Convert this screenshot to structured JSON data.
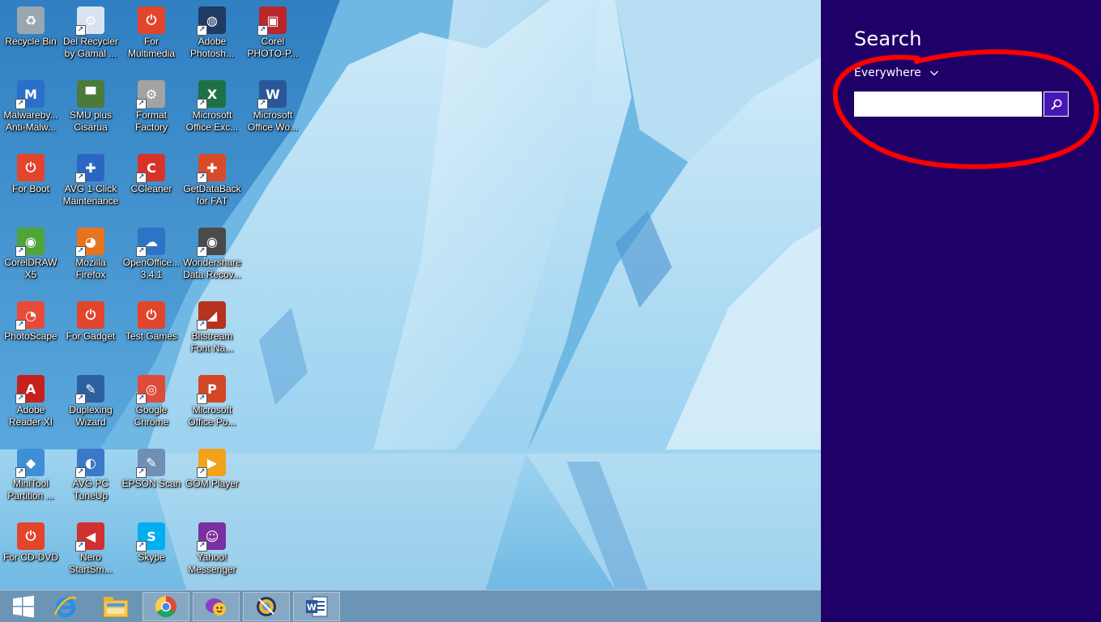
{
  "desktop": {
    "icons": [
      {
        "label": "Recycle Bin",
        "icon": "recycle-bin-icon",
        "color": "#9aa7b2",
        "glyph": "♻",
        "shortcut": false
      },
      {
        "label": "Malwareby... Anti-Malw...",
        "icon": "malwarebytes-icon",
        "color": "#2a6fc9",
        "glyph": "M",
        "shortcut": true
      },
      {
        "label": "For Boot",
        "icon": "power-icon",
        "color": "#e2442c",
        "glyph": "⏻",
        "shortcut": false
      },
      {
        "label": "CorelDRAW X5",
        "icon": "coreldraw-icon",
        "color": "#4fa43a",
        "glyph": "◉",
        "shortcut": true
      },
      {
        "label": "PhotoScape",
        "icon": "photoscape-icon",
        "color": "#e84a3a",
        "glyph": "◔",
        "shortcut": true
      },
      {
        "label": "Adobe Reader XI",
        "icon": "adobe-reader-icon",
        "color": "#c8201b",
        "glyph": "A",
        "shortcut": true
      },
      {
        "label": "MiniTool Partition ...",
        "icon": "minitool-icon",
        "color": "#3f8fd6",
        "glyph": "◆",
        "shortcut": true
      },
      {
        "label": "For CD-DVD",
        "icon": "power-icon",
        "color": "#e2442c",
        "glyph": "⏻",
        "shortcut": false
      },
      {
        "label": "Del Recycler by Gamal ...",
        "icon": "del-recycler-icon",
        "color": "#d7e3ee",
        "glyph": "⚙",
        "shortcut": true
      },
      {
        "label": "SMU plus Cisarua",
        "icon": "image-file-icon",
        "color": "#4c7a3a",
        "glyph": "▀",
        "shortcut": false
      },
      {
        "label": "AVG 1-Click Maintenance",
        "icon": "avg-icon",
        "color": "#2c66c3",
        "glyph": "✚",
        "shortcut": true
      },
      {
        "label": "Mozilla Firefox",
        "icon": "firefox-icon",
        "color": "#e8731d",
        "glyph": "◕",
        "shortcut": true
      },
      {
        "label": "For Gadget",
        "icon": "power-icon",
        "color": "#e2442c",
        "glyph": "⏻",
        "shortcut": false
      },
      {
        "label": "Duplexing Wizard",
        "icon": "duplexing-wizard-icon",
        "color": "#2d5f9e",
        "glyph": "✎",
        "shortcut": true
      },
      {
        "label": "AVG PC TuneUp",
        "icon": "tuneup-icon",
        "color": "#3b79c8",
        "glyph": "◐",
        "shortcut": true
      },
      {
        "label": "Nero StartSm...",
        "icon": "nero-icon",
        "color": "#d0302e",
        "glyph": "◀",
        "shortcut": true
      },
      {
        "label": "For Multimedia",
        "icon": "power-icon",
        "color": "#e2442c",
        "glyph": "⏻",
        "shortcut": false
      },
      {
        "label": "Format Factory",
        "icon": "format-factory-icon",
        "color": "#a3a3a3",
        "glyph": "⚙",
        "shortcut": true
      },
      {
        "label": "CCleaner",
        "icon": "ccleaner-icon",
        "color": "#d8332a",
        "glyph": "C",
        "shortcut": true
      },
      {
        "label": "OpenOffice... 3.4.1",
        "icon": "openoffice-icon",
        "color": "#2f73c7",
        "glyph": "☁",
        "shortcut": true
      },
      {
        "label": "Test Games",
        "icon": "power-icon",
        "color": "#e2442c",
        "glyph": "⏻",
        "shortcut": false
      },
      {
        "label": "Google Chrome",
        "icon": "chrome-icon",
        "color": "#de4b39",
        "glyph": "◎",
        "shortcut": true
      },
      {
        "label": "EPSON Scan",
        "icon": "epson-scan-icon",
        "color": "#6f8fb6",
        "glyph": "✎",
        "shortcut": true
      },
      {
        "label": "Skype",
        "icon": "skype-icon",
        "color": "#00aff0",
        "glyph": "S",
        "shortcut": true
      },
      {
        "label": "Adobe Photosh...",
        "icon": "photoshop-icon",
        "color": "#1f3a63",
        "glyph": "◍",
        "shortcut": true
      },
      {
        "label": "Microsoft Office Exc...",
        "icon": "excel-icon",
        "color": "#1e7145",
        "glyph": "X",
        "shortcut": true
      },
      {
        "label": "GetDataBack for FAT",
        "icon": "getdataback-icon",
        "color": "#d84b2a",
        "glyph": "✚",
        "shortcut": true
      },
      {
        "label": "Wondershare Data Recov...",
        "icon": "wondershare-icon",
        "color": "#4a4a4a",
        "glyph": "◉",
        "shortcut": true
      },
      {
        "label": "Bitstream Font Na...",
        "icon": "bitstream-icon",
        "color": "#b7331f",
        "glyph": "◢",
        "shortcut": true
      },
      {
        "label": "Microsoft Office Po...",
        "icon": "powerpoint-icon",
        "color": "#d24726",
        "glyph": "P",
        "shortcut": true
      },
      {
        "label": "GOM Player",
        "icon": "gom-player-icon",
        "color": "#f2a21b",
        "glyph": "▶",
        "shortcut": true
      },
      {
        "label": "Yahoo! Messenger",
        "icon": "yahoo-messenger-icon",
        "color": "#7b2fa3",
        "glyph": "☺",
        "shortcut": true
      },
      {
        "label": "Corel PHOTO-P...",
        "icon": "corel-photo-paint-icon",
        "color": "#b9262b",
        "glyph": "▣",
        "shortcut": true
      },
      {
        "label": "Microsoft Office Wo...",
        "icon": "word-icon",
        "color": "#2b579a",
        "glyph": "W",
        "shortcut": true
      }
    ]
  },
  "taskbar": {
    "items": [
      {
        "icon": "windows-start-icon",
        "running": false
      },
      {
        "icon": "internet-explorer-icon",
        "running": false
      },
      {
        "icon": "file-explorer-icon",
        "running": false
      },
      {
        "icon": "chrome-icon",
        "running": true
      },
      {
        "icon": "yahoo-messenger-icon",
        "running": true
      },
      {
        "icon": "photoshop-icon",
        "running": true
      },
      {
        "icon": "word-icon",
        "running": true
      }
    ]
  },
  "search": {
    "title": "Search",
    "scope": "Everywhere",
    "query": "",
    "placeholder": ""
  },
  "colors": {
    "charm_background": "#1f0068",
    "search_button": "#4617b4",
    "annotation": "#ff0000"
  }
}
